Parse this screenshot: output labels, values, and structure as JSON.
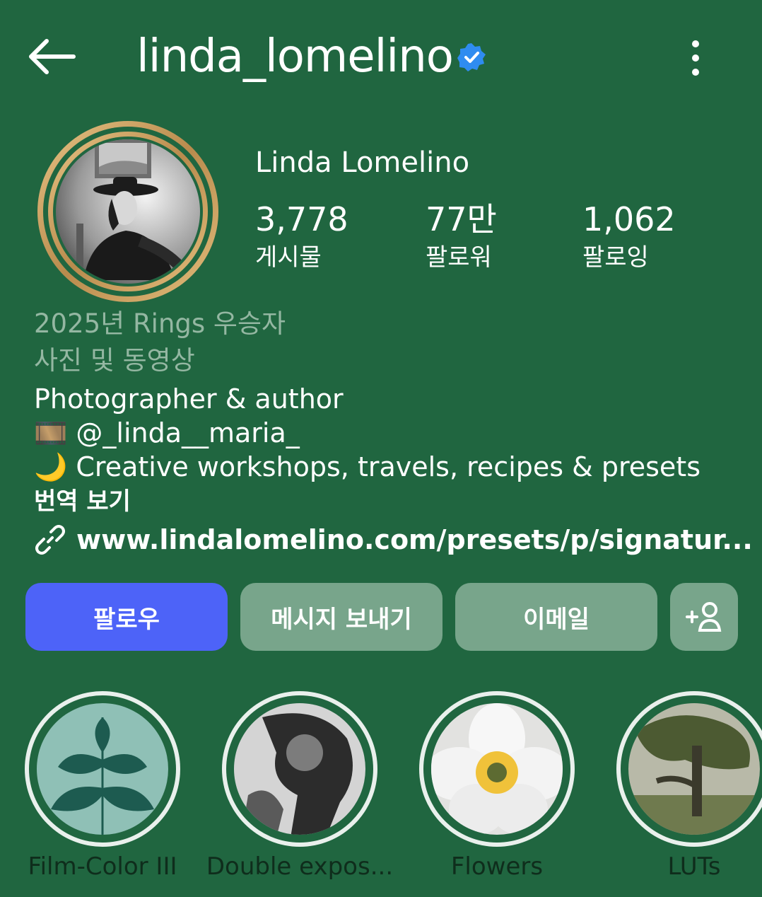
{
  "header": {
    "username": "linda_lomelino",
    "back_icon": "arrow-left-icon",
    "verified_icon": "verified-badge-icon",
    "more_icon": "more-vertical-icon"
  },
  "profile": {
    "full_name": "Linda Lomelino",
    "stats": [
      {
        "value": "3,778",
        "label": "게시물"
      },
      {
        "value": "77만",
        "label": "팔로워"
      },
      {
        "value": "1,062",
        "label": "팔로잉"
      }
    ],
    "award": "2025년 Rings 우승자",
    "category": "사진 및 동영상",
    "bio_lines": [
      "Photographer & author",
      "🎞️ @_linda__maria_",
      "🌙 Creative workshops, travels, recipes & presets"
    ],
    "translate_label": "번역 보기",
    "link_icon": "link-icon",
    "link_text": "www.lindalomelino.com/presets/p/signatur..."
  },
  "actions": {
    "follow": "팔로우",
    "message": "메시지 보내기",
    "email": "이메일",
    "add_person_icon": "add-person-icon"
  },
  "highlights": [
    {
      "label": "Film-Color III"
    },
    {
      "label": "Double expos..."
    },
    {
      "label": "Flowers"
    },
    {
      "label": "LUTs"
    }
  ],
  "colors": {
    "background": "#206640",
    "follow_button": "#4d63f8",
    "secondary_button": "#78a58b",
    "muted_text": "#94b7a2",
    "highlight_label": "#0f2d1c",
    "verified_blue": "#2f8cf0",
    "avatar_ring_gold": "#c9a063"
  }
}
